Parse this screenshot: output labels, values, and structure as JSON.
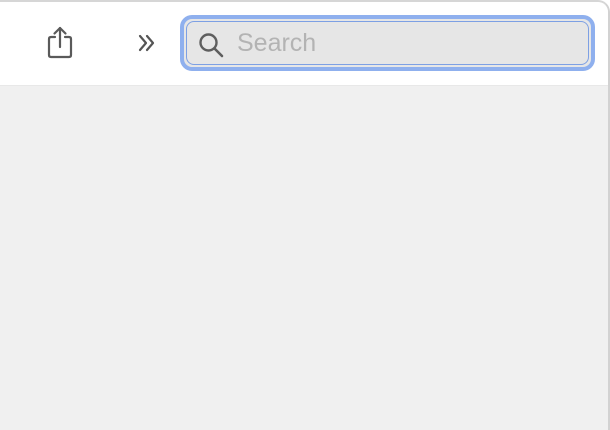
{
  "toolbar": {
    "share_icon": "share-icon",
    "overflow_icon": "chevron-double-right-icon",
    "search": {
      "placeholder": "Search",
      "value": "",
      "icon": "search-icon"
    }
  },
  "colors": {
    "toolbar_background": "#ffffff",
    "content_background": "#f0f0f0",
    "search_focus_ring": "#8fb0ee",
    "search_background": "#e6e6e6",
    "icon_color": "#555555",
    "placeholder_color": "#b3b3b3"
  }
}
